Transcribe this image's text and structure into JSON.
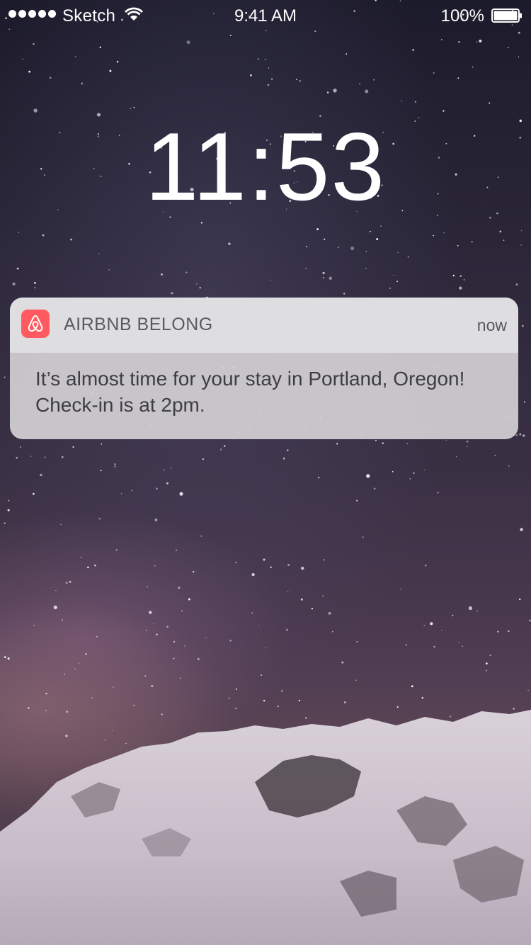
{
  "status_bar": {
    "carrier": "Sketch",
    "time": "9:41 AM",
    "battery_percent": "100%",
    "signal_bars": 5,
    "battery_level": 1.0
  },
  "lock_screen": {
    "clock": "11:53"
  },
  "notification": {
    "app_name": "AIRBNB BELONG",
    "time": "now",
    "message": "It’s almost time for your stay in Portland, Oregon! Check-in is at 2pm.",
    "app_icon": "airbnb-logo-icon",
    "accent_color": "#ff5a5f"
  },
  "wallpaper": {
    "icons": [
      "starry-sky",
      "snowy-mountain"
    ]
  }
}
